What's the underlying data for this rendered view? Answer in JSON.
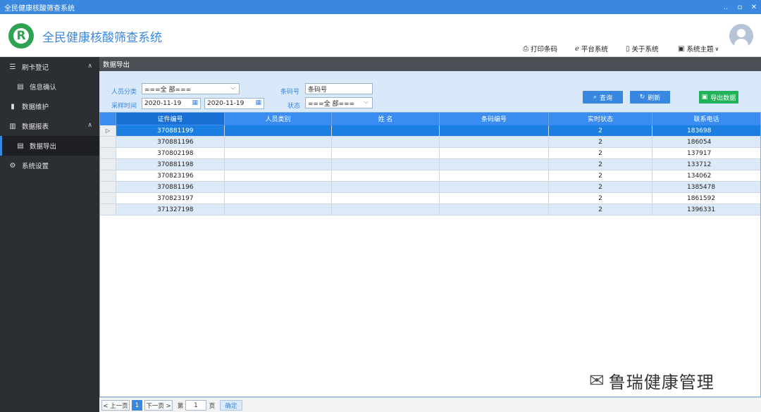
{
  "window": {
    "title": "全民健康核酸筛查系统",
    "controls": [
      "‥",
      "▫",
      "✕"
    ]
  },
  "header": {
    "logo_letter": "R",
    "app_title": "全民健康核酸筛查系统",
    "links": [
      {
        "label": "打印条码",
        "icon": "print-icon"
      },
      {
        "label": "平台系统",
        "icon": "browser-icon"
      },
      {
        "label": "关于系统",
        "icon": "book-icon"
      },
      {
        "label": "系统主题",
        "icon": "image-icon",
        "caret": "∨"
      }
    ]
  },
  "sidebar": {
    "items": [
      {
        "label": "刷卡登记",
        "icon": "list-icon",
        "chevron": "∧"
      },
      {
        "label": "信息确认",
        "icon": "card-icon"
      },
      {
        "label": "数据维护",
        "icon": "book-icon"
      },
      {
        "label": "数据报表",
        "icon": "bar-chart-icon",
        "chevron": "∧"
      },
      {
        "label": "数据导出",
        "icon": "document-icon"
      },
      {
        "label": "系统设置",
        "icon": "gear-icon"
      }
    ]
  },
  "section_title": "数据导出",
  "filter": {
    "person_type_label": "人员分类",
    "person_type_value": "===全  部===",
    "sample_time_label": "采样时间",
    "date_from": "2020-11-19",
    "date_to": "2020-11-19",
    "barcode_label": "条码号",
    "barcode_placeholder": "条码号",
    "status_label": "状态",
    "status_value": "===全  部===",
    "query_label": "查询",
    "refresh_label": "刷新",
    "export_label": "导出数据"
  },
  "table": {
    "columns": [
      "证件编号",
      "人员类别",
      "姓    名",
      "条码编号",
      "实时状态",
      "联系电话"
    ],
    "rows": [
      {
        "id": "370881199",
        "type": "",
        "name": "",
        "barcode": "",
        "status": "2",
        "phone": "183698"
      },
      {
        "id": "370881196",
        "type": "",
        "name": "",
        "barcode": "",
        "status": "2",
        "phone": "186054"
      },
      {
        "id": "370802198",
        "type": "",
        "name": "",
        "barcode": "",
        "status": "2",
        "phone": "137917"
      },
      {
        "id": "370881198",
        "type": "",
        "name": "",
        "barcode": "",
        "status": "2",
        "phone": "133712"
      },
      {
        "id": "370823196",
        "type": "",
        "name": "",
        "barcode": "",
        "status": "2",
        "phone": "134062"
      },
      {
        "id": "370881196",
        "type": "",
        "name": "",
        "barcode": "",
        "status": "2",
        "phone": "1385478"
      },
      {
        "id": "370823197",
        "type": "",
        "name": "",
        "barcode": "",
        "status": "2",
        "phone": "1861592"
      },
      {
        "id": "371327198",
        "type": "",
        "name": "",
        "barcode": "",
        "status": "2",
        "phone": "1396331"
      }
    ],
    "selected_row": 0,
    "row_marker": "▷"
  },
  "pager": {
    "prev_label": "< 上一页",
    "current_page": "1",
    "next_label": "下一页 >",
    "page_prefix": "第",
    "page_input": "1",
    "page_suffix": "页",
    "confirm_label": "确定"
  },
  "watermark": {
    "text": "鲁瑞健康管理",
    "icon": "wechat-icon"
  },
  "colors": {
    "accent": "#3a87e0",
    "sidebar": "#2b2e33",
    "header_row": "#3a8cf0",
    "selected_row": "#1a7fe0",
    "alt_row": "#dce9f8",
    "export_button": "#22b35a"
  }
}
